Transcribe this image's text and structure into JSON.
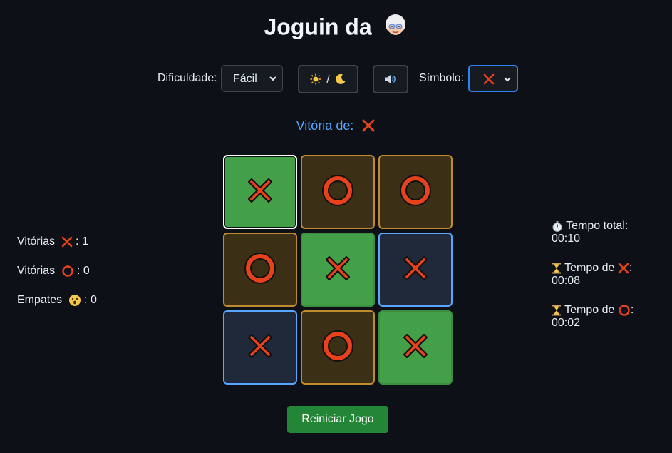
{
  "header": {
    "title": "Joguin da",
    "title_icon": "grandma-emoji-icon"
  },
  "controls": {
    "difficulty_label": "Dificuldade:",
    "difficulty_value": "Fácil",
    "theme_toggle_label": "/",
    "sound_icon": "speaker-icon",
    "symbol_label": "Símbolo:",
    "symbol_value": "X"
  },
  "status": {
    "text": "Vitória de:",
    "winner": "X"
  },
  "board": {
    "cells": [
      {
        "mark": "X",
        "state": "win"
      },
      {
        "mark": "O",
        "state": "normal"
      },
      {
        "mark": "O",
        "state": "normal"
      },
      {
        "mark": "O",
        "state": "normal"
      },
      {
        "mark": "X",
        "state": "win"
      },
      {
        "mark": "X",
        "state": "blue"
      },
      {
        "mark": "X",
        "state": "blue"
      },
      {
        "mark": "O",
        "state": "normal"
      },
      {
        "mark": "X",
        "state": "win"
      }
    ]
  },
  "scores": {
    "wins_label": "Vitórias",
    "x_wins": ": 1",
    "o_wins": ": 0",
    "draws_label": "Empates",
    "draws": ": 0"
  },
  "timers": {
    "total_label": "Tempo total:",
    "total_value": "00:10",
    "x_label": "Tempo de",
    "x_value": "00:08",
    "o_label": "Tempo de",
    "o_value": "00:02",
    "colon": ":"
  },
  "actions": {
    "reset_label": "Reiniciar Jogo"
  },
  "colors": {
    "background": "#0d1117",
    "mark_red": "#e8421d",
    "win_green": "#44a048",
    "cell_amber": "#c08a2e",
    "cell_blue": "#58a6ff",
    "reset_green": "#238636",
    "status_blue": "#58a6ff"
  }
}
